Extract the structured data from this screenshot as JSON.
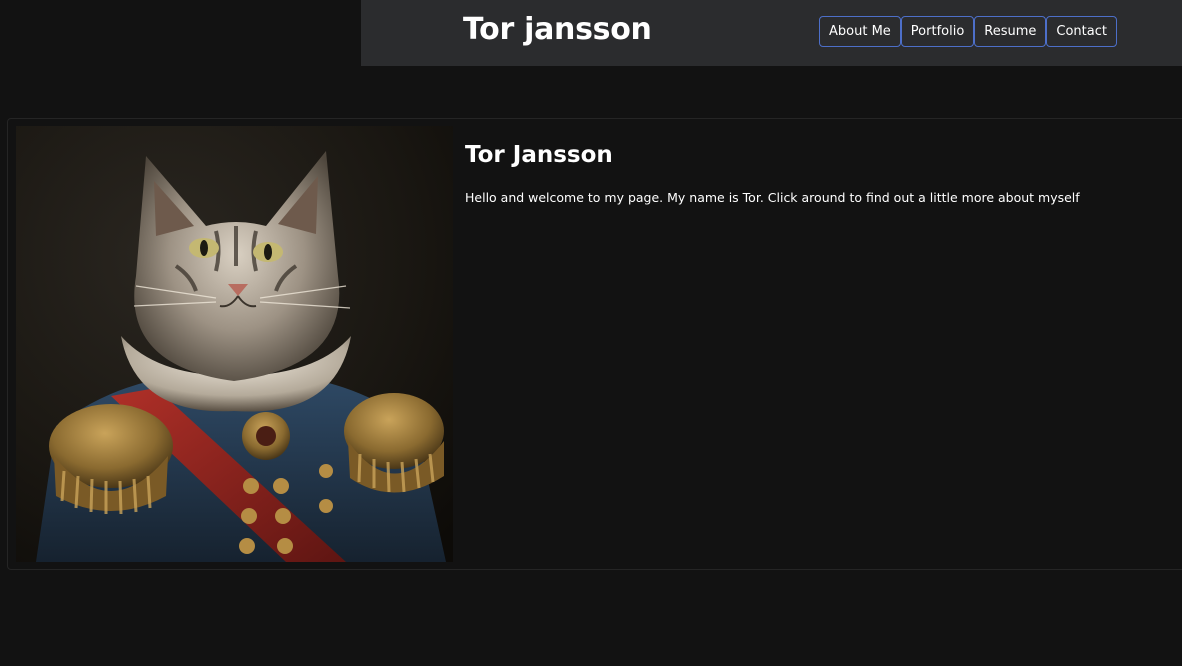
{
  "header": {
    "title": "Tor jansson",
    "nav": [
      {
        "label": "About Me"
      },
      {
        "label": "Portfolio"
      },
      {
        "label": "Resume"
      },
      {
        "label": "Contact"
      }
    ]
  },
  "profile": {
    "name": "Tor Jansson",
    "intro": "Hello and welcome to my page. My name is Tor. Click around to find out a little more about myself",
    "image": "cat-portrait-painting"
  },
  "colors": {
    "background": "#121212",
    "header_bg": "#2b2c2e",
    "nav_border": "#4d6fc9",
    "card_border": "#252525"
  }
}
